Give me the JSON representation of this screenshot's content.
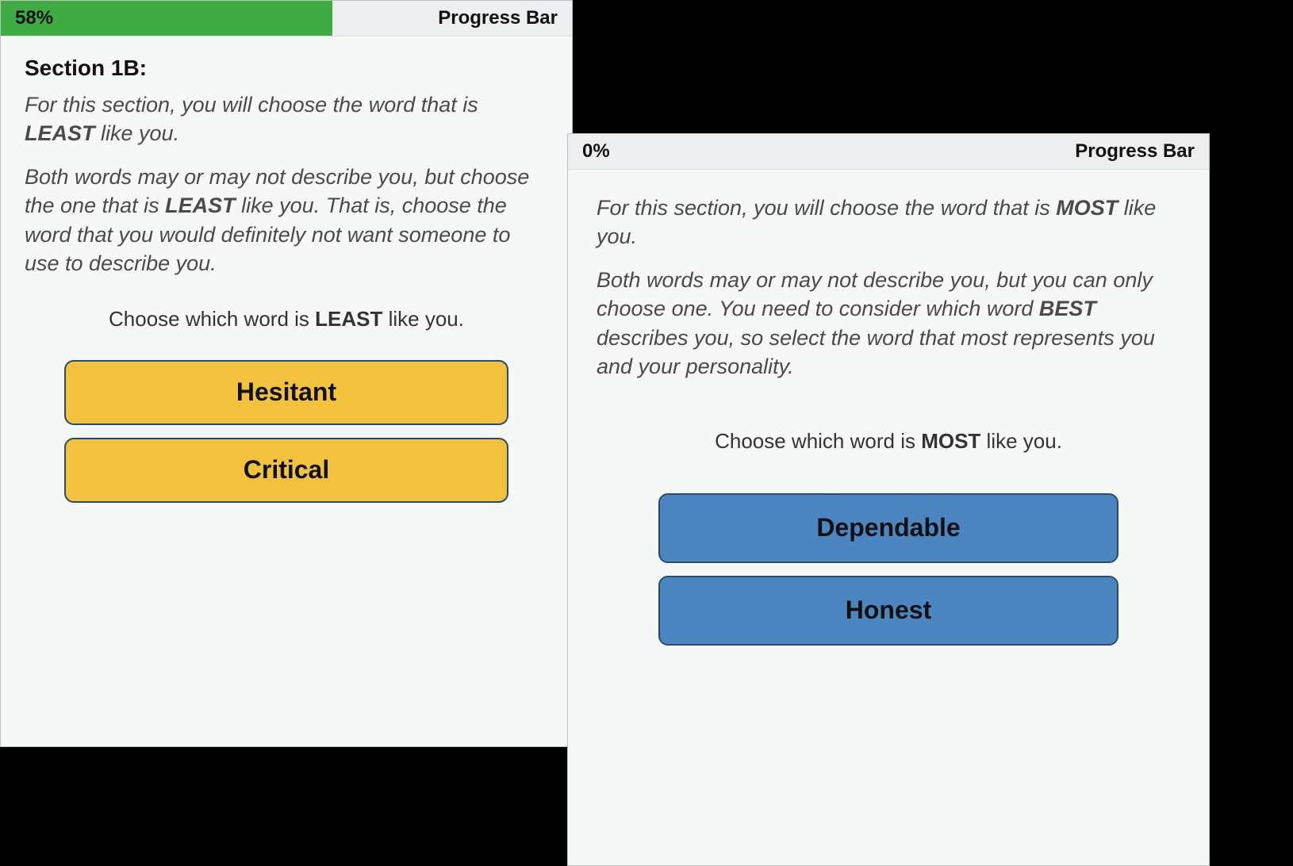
{
  "left": {
    "progress": {
      "percent": 58,
      "percent_text": "58%",
      "label": "Progress Bar",
      "fill_color": "#3eac43"
    },
    "section_title": "Section 1B:",
    "intro1_a": "For this section, you will choose the word that is ",
    "intro1_b": "LEAST",
    "intro1_c": " like you.",
    "intro2_a": "Both words may or may not describe you, but choose the one that is ",
    "intro2_b": "LEAST",
    "intro2_c": " like you. That is, choose the word that you would definitely not want someone to use to describe you.",
    "prompt_a": "Choose which word is ",
    "prompt_b": "LEAST",
    "prompt_c": " like you.",
    "choices": {
      "a": "Hesitant",
      "b": "Critical"
    }
  },
  "right": {
    "progress": {
      "percent": 0,
      "percent_text": "0%",
      "label": "Progress Bar"
    },
    "intro1_a": "For this section, you will choose the word that is ",
    "intro1_b": "MOST",
    "intro1_c": " like you.",
    "intro2_a": "Both words may or may not describe you, but you can only choose one. You need to consider which word ",
    "intro2_b": "BEST",
    "intro2_c": " describes you, so select the word that most represents you and your personality.",
    "prompt_a": "Choose which word is ",
    "prompt_b": "MOST",
    "prompt_c": " like you.",
    "choices": {
      "a": "Dependable",
      "b": "Honest"
    }
  }
}
